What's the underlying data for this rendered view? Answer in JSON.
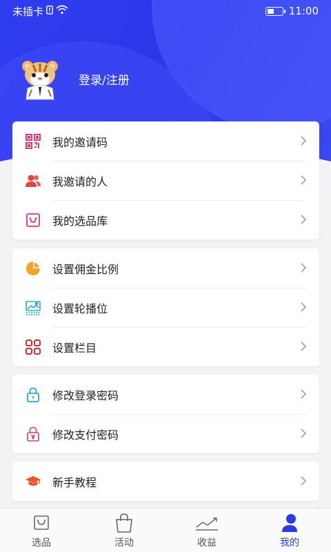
{
  "status_bar": {
    "carrier": "未插卡",
    "time": "11:00"
  },
  "profile": {
    "login_label": "登录/注册"
  },
  "groups": [
    {
      "items": [
        {
          "label": "我的邀请码",
          "icon": "qr-code-icon"
        },
        {
          "label": "我邀请的人",
          "icon": "people-icon"
        },
        {
          "label": "我的选品库",
          "icon": "shopping-bag-icon"
        }
      ]
    },
    {
      "items": [
        {
          "label": "设置佣金比例",
          "icon": "pie-chart-icon"
        },
        {
          "label": "设置轮播位",
          "icon": "image-carousel-icon"
        },
        {
          "label": "设置栏目",
          "icon": "grid-icon"
        }
      ]
    },
    {
      "items": [
        {
          "label": "修改登录密码",
          "icon": "lock-icon"
        },
        {
          "label": "修改支付密码",
          "icon": "pay-lock-icon"
        }
      ]
    },
    {
      "items": [
        {
          "label": "新手教程",
          "icon": "graduation-cap-icon"
        }
      ]
    }
  ],
  "tabbar": {
    "tabs": [
      {
        "label": "选品",
        "icon": "bag-icon",
        "active": false
      },
      {
        "label": "活动",
        "icon": "shopping-bag-icon",
        "active": false
      },
      {
        "label": "收益",
        "icon": "trend-icon",
        "active": false
      },
      {
        "label": "我的",
        "icon": "user-icon",
        "active": true
      }
    ]
  },
  "colors": {
    "primary": "#2a3be3",
    "icon_pink": "#d23a7a",
    "icon_red": "#e0463c",
    "icon_orange": "#f2a32a",
    "icon_teal": "#2aa7c9",
    "icon_darkred": "#c4303a"
  }
}
